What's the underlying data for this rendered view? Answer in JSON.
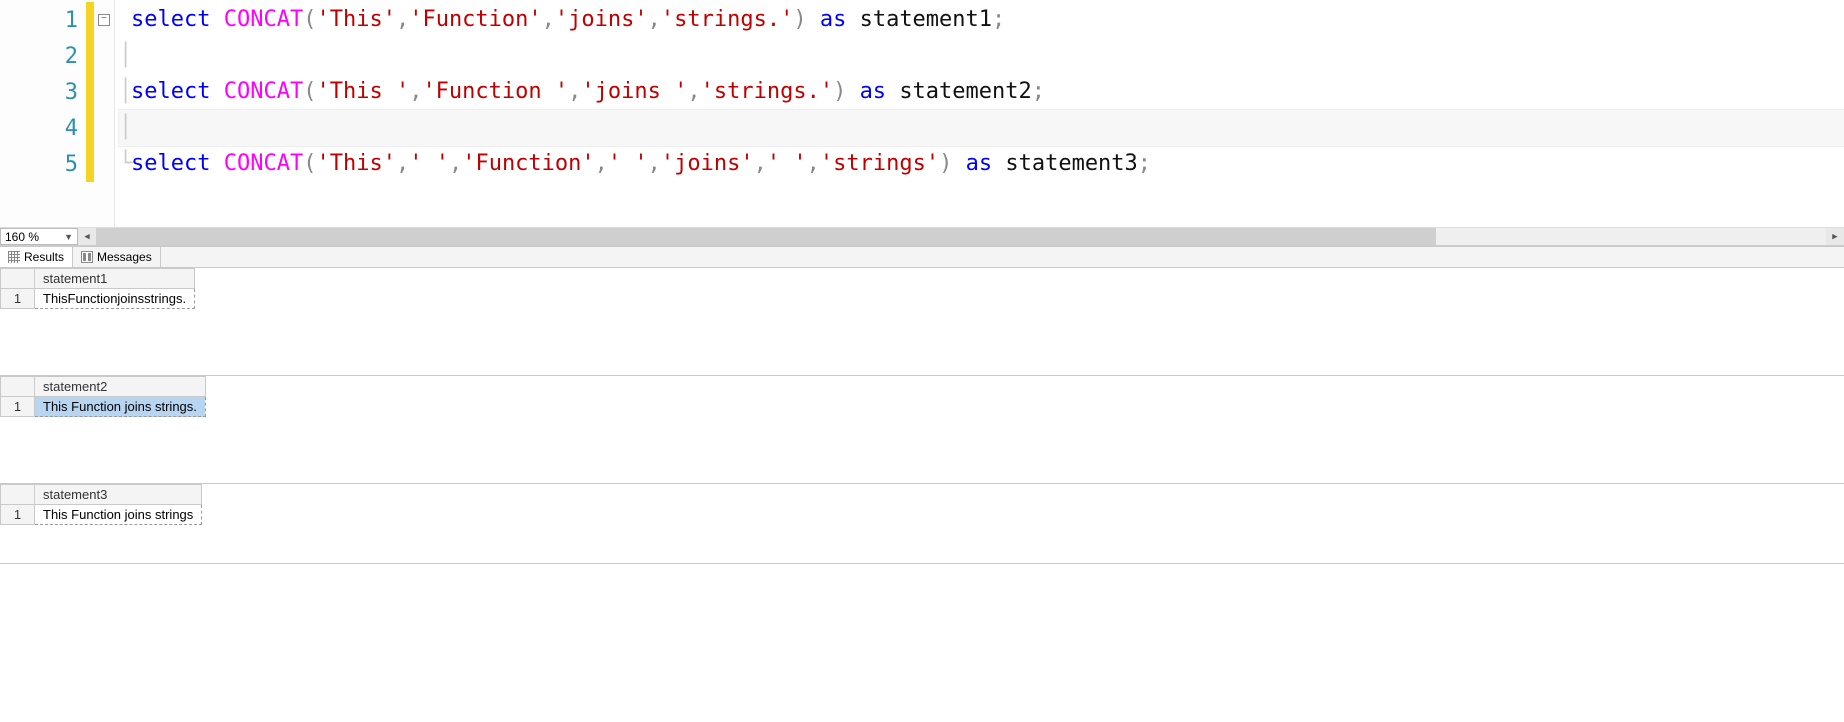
{
  "editor": {
    "zoom": "160 %",
    "lines": [
      {
        "num": "1",
        "fold": true,
        "tokens": [
          {
            "t": "kw",
            "v": "select"
          },
          {
            "t": "plain",
            "v": " "
          },
          {
            "t": "fn",
            "v": "CONCAT"
          },
          {
            "t": "paren",
            "v": "("
          },
          {
            "t": "str",
            "v": "'This'"
          },
          {
            "t": "paren",
            "v": ","
          },
          {
            "t": "str",
            "v": "'Function'"
          },
          {
            "t": "paren",
            "v": ","
          },
          {
            "t": "str",
            "v": "'joins'"
          },
          {
            "t": "paren",
            "v": ","
          },
          {
            "t": "str",
            "v": "'strings.'"
          },
          {
            "t": "paren",
            "v": ")"
          },
          {
            "t": "plain",
            "v": " "
          },
          {
            "t": "kw",
            "v": "as"
          },
          {
            "t": "plain",
            "v": " "
          },
          {
            "t": "ident",
            "v": "statement1"
          },
          {
            "t": "paren",
            "v": ";"
          }
        ]
      },
      {
        "num": "2",
        "tokens": []
      },
      {
        "num": "3",
        "tokens": [
          {
            "t": "kw",
            "v": "select"
          },
          {
            "t": "plain",
            "v": " "
          },
          {
            "t": "fn",
            "v": "CONCAT"
          },
          {
            "t": "paren",
            "v": "("
          },
          {
            "t": "str",
            "v": "'This '"
          },
          {
            "t": "paren",
            "v": ","
          },
          {
            "t": "str",
            "v": "'Function '"
          },
          {
            "t": "paren",
            "v": ","
          },
          {
            "t": "str",
            "v": "'joins '"
          },
          {
            "t": "paren",
            "v": ","
          },
          {
            "t": "str",
            "v": "'strings.'"
          },
          {
            "t": "paren",
            "v": ")"
          },
          {
            "t": "plain",
            "v": " "
          },
          {
            "t": "kw",
            "v": "as"
          },
          {
            "t": "plain",
            "v": " "
          },
          {
            "t": "ident",
            "v": "statement2"
          },
          {
            "t": "paren",
            "v": ";"
          }
        ]
      },
      {
        "num": "4",
        "current": true,
        "tokens": []
      },
      {
        "num": "5",
        "tokens": [
          {
            "t": "kw",
            "v": "select"
          },
          {
            "t": "plain",
            "v": " "
          },
          {
            "t": "fn",
            "v": "CONCAT"
          },
          {
            "t": "paren",
            "v": "("
          },
          {
            "t": "str",
            "v": "'This'"
          },
          {
            "t": "paren",
            "v": ","
          },
          {
            "t": "str",
            "v": "' '"
          },
          {
            "t": "paren",
            "v": ","
          },
          {
            "t": "str",
            "v": "'Function'"
          },
          {
            "t": "paren",
            "v": ","
          },
          {
            "t": "str",
            "v": "' '"
          },
          {
            "t": "paren",
            "v": ","
          },
          {
            "t": "str",
            "v": "'joins'"
          },
          {
            "t": "paren",
            "v": ","
          },
          {
            "t": "str",
            "v": "' '"
          },
          {
            "t": "paren",
            "v": ","
          },
          {
            "t": "str",
            "v": "'strings'"
          },
          {
            "t": "paren",
            "v": ")"
          },
          {
            "t": "plain",
            "v": " "
          },
          {
            "t": "kw",
            "v": "as"
          },
          {
            "t": "plain",
            "v": " "
          },
          {
            "t": "ident",
            "v": "statement3"
          },
          {
            "t": "paren",
            "v": ";"
          }
        ]
      }
    ]
  },
  "tabs": {
    "results": "Results",
    "messages": "Messages"
  },
  "results": [
    {
      "header": "statement1",
      "row_num": "1",
      "value": "ThisFunctionjoinsstrings.",
      "selected": false
    },
    {
      "header": "statement2",
      "row_num": "1",
      "value": "This Function joins strings.",
      "selected": true
    },
    {
      "header": "statement3",
      "row_num": "1",
      "value": "This Function joins strings",
      "selected": false
    }
  ]
}
